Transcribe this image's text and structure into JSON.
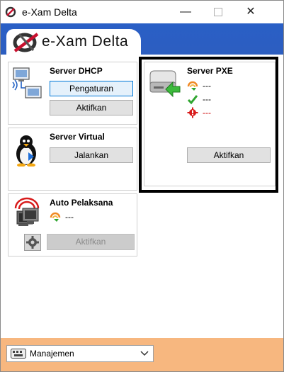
{
  "window": {
    "title": "e-Xam Delta",
    "minimize_glyph": "—",
    "close_glyph": "✕"
  },
  "header": {
    "tab_label": "e-Xam Delta"
  },
  "panels": {
    "dhcp": {
      "title": "Server DHCP",
      "icon": "network-computer-icon",
      "buttons": [
        "Pengaturan",
        "Aktifkan"
      ]
    },
    "virtual": {
      "title": "Server Virtual",
      "icon": "linux-penguin-icon",
      "buttons": [
        "Jalankan"
      ]
    },
    "auto": {
      "title": "Auto Pelaksana",
      "icon": "auto-monitor-icon",
      "status": "---",
      "buttons": [
        "Aktifkan"
      ]
    },
    "pxe": {
      "title": "Server PXE",
      "icon": "pxe-drive-icon",
      "status": [
        {
          "icon": "sync-icon",
          "text": "---",
          "color": "#000000"
        },
        {
          "icon": "checkmark-icon",
          "text": "---",
          "color": "#000000"
        },
        {
          "icon": "error-gear-icon",
          "text": "---",
          "color": "#cc0000"
        }
      ],
      "buttons": [
        "Aktifkan"
      ]
    }
  },
  "footer": {
    "selected": "Manajemen",
    "icon": "keyboard-icon"
  },
  "colors": {
    "header_blue": "#2c5ec0",
    "footer_orange": "#f7b77f",
    "highlight_border": "#000000",
    "error_red": "#cc0000"
  }
}
